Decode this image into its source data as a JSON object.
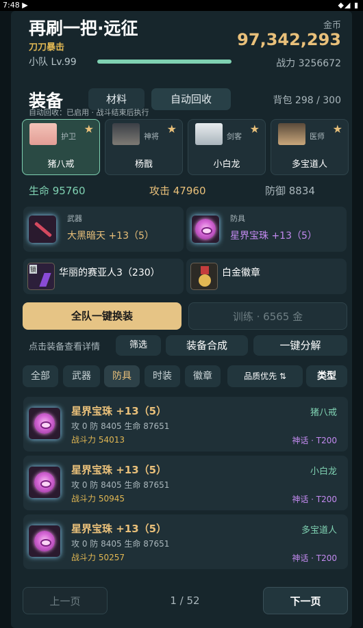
{
  "status_bar": {
    "time": "7:48 ▶",
    "icons": "◆◢ ▮"
  },
  "header": {
    "title": "再刷一把·远征",
    "subtitle": "刀刀暴击",
    "coin_label": "金币",
    "coins": "97,342,293",
    "team_level": "小队 Lv.99",
    "xp_fraction": 1.0,
    "power": "战力 3256672"
  },
  "equip_section": {
    "title": "装备",
    "tabs": [
      "材料",
      "自动回收"
    ],
    "bag": "背包 298 / 300",
    "auto_status": "自动回收：已启用 · 战斗结束后执行"
  },
  "heroes": [
    {
      "role": "护卫",
      "name": "猪八戒",
      "star": "★",
      "selected": true
    },
    {
      "role": "神将",
      "name": "杨戬",
      "star": "★",
      "selected": false
    },
    {
      "role": "剑客",
      "name": "小白龙",
      "star": "★",
      "selected": false
    },
    {
      "role": "医师",
      "name": "多宝道人",
      "star": "★",
      "selected": false
    }
  ],
  "stats": {
    "hp": "生命 95760",
    "atk": "攻击 47960",
    "def": "防御 8834"
  },
  "slots": {
    "weapon": {
      "label": "武器",
      "name": "大黑暗天 +13（5）"
    },
    "armor": {
      "label": "防具",
      "name": "星界宝珠 +13（5）"
    },
    "accessory": {
      "name": "华丽的赛亚人3（230）",
      "lock_badge": "锁"
    },
    "badge": {
      "name": "白金徽章"
    }
  },
  "actions": {
    "equip_all": "全队一键换装",
    "train": "训练 · 6565 金",
    "hint": "点击装备查看详情",
    "screen": "筛选",
    "synth": "装备合成",
    "decompose": "一键分解"
  },
  "filters": [
    "全部",
    "武器",
    "防具",
    "时装",
    "徽章"
  ],
  "sort": "品质优先 ⇅",
  "type_btn": "类型",
  "colors": {
    "accent_gold": "#e9c07a",
    "accent_green": "#7fd1b2",
    "myth_purple": "#c38af0"
  },
  "items": [
    {
      "name": "星界宝珠 +13（5）",
      "stats": "攻 0  防 8405  生命 87651",
      "power": "战斗力 54013",
      "owner": "猪八戒",
      "tier": "神话 · T200"
    },
    {
      "name": "星界宝珠 +13（5）",
      "stats": "攻 0  防 8405  生命 87651",
      "power": "战斗力 50945",
      "owner": "小白龙",
      "tier": "神话 · T200"
    },
    {
      "name": "星界宝珠 +13（5）",
      "stats": "攻 0  防 8405  生命 87651",
      "power": "战斗力 50257",
      "owner": "多宝道人",
      "tier": "神话 · T200"
    }
  ],
  "pager": {
    "prev": "上一页",
    "page": "1 / 52",
    "next": "下一页"
  }
}
